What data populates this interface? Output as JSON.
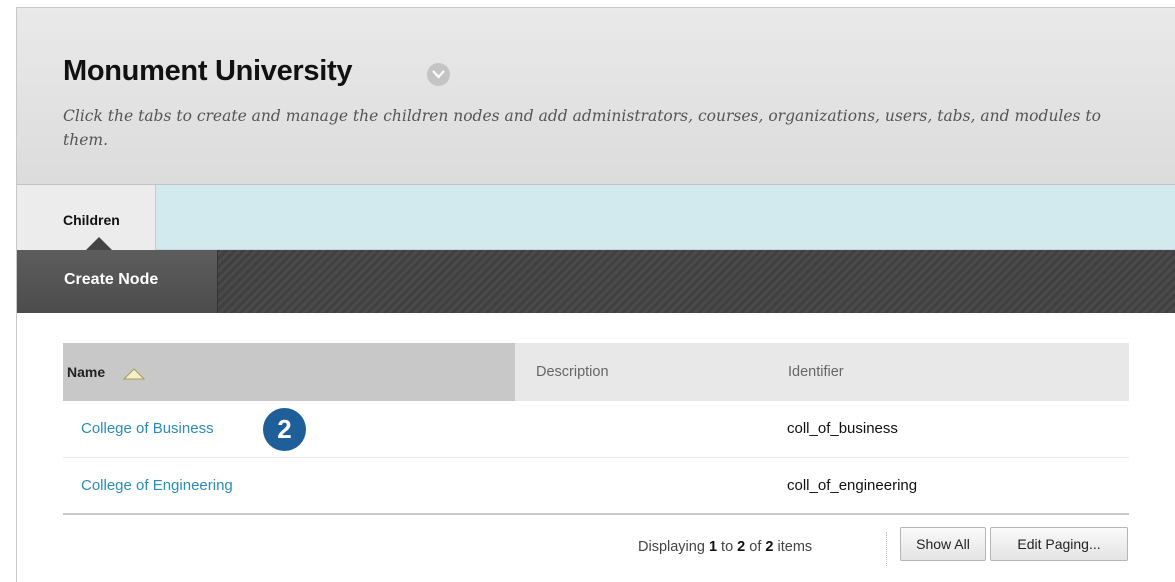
{
  "header": {
    "title": "Monument University",
    "description": "Click the tabs to create and manage the children nodes and add administrators, courses, organizations, users, tabs, and modules to them."
  },
  "tabs": [
    {
      "label": "Children",
      "active": true
    }
  ],
  "action_bar": {
    "create_node_label": "Create Node"
  },
  "table": {
    "columns": [
      "Name",
      "Description",
      "Identifier"
    ],
    "sort": {
      "column": "Name",
      "direction": "ascending"
    },
    "rows": [
      {
        "name": "College of Business",
        "description": "",
        "identifier": "coll_of_business"
      },
      {
        "name": "College of Engineering",
        "description": "",
        "identifier": "coll_of_engineering"
      }
    ]
  },
  "callout": {
    "number": "2"
  },
  "paging": {
    "prefix": "Displaying",
    "from": "1",
    "to_word": "to",
    "to": "2",
    "of_word": "of",
    "total": "2",
    "suffix": "items",
    "show_all_label": "Show All",
    "edit_paging_label": "Edit Paging..."
  },
  "colors": {
    "link": "#2b8cb8",
    "tab_strip": "#d2eaee",
    "action_bar": "#4a4a4a",
    "callout": "#1f5f99"
  },
  "icons": {
    "title_menu": "chevron-down-icon",
    "sort": "sort-ascending-icon"
  }
}
